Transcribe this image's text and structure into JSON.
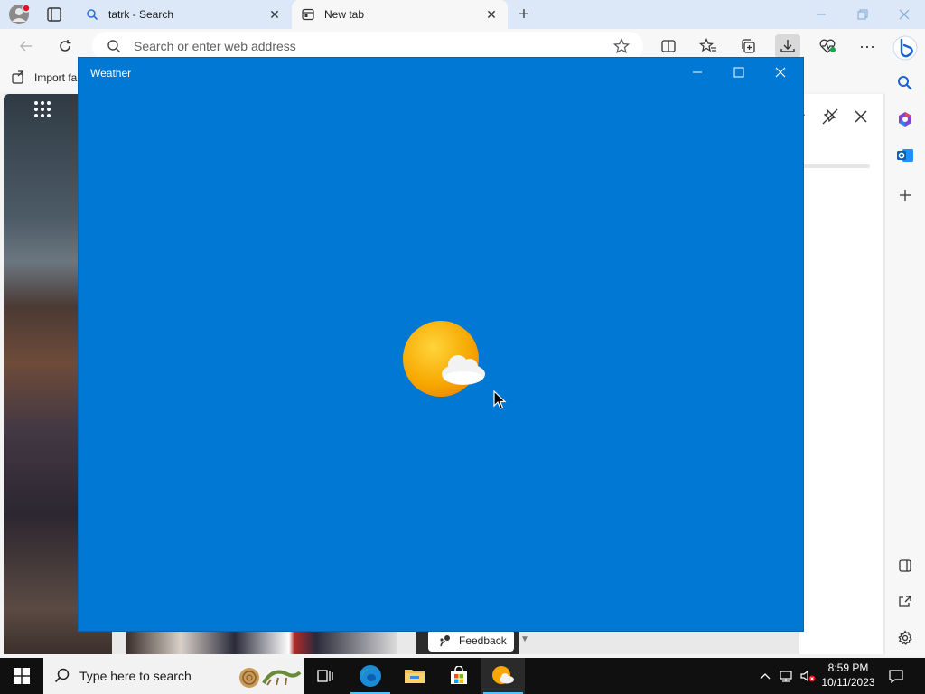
{
  "browser": {
    "tabs": [
      {
        "label": "tatrk - Search",
        "active": false
      },
      {
        "label": "New tab",
        "active": true
      }
    ],
    "address_bar": {
      "placeholder": "Search or enter web address",
      "value": ""
    },
    "favorites_bar": {
      "import_label": "Import fa"
    }
  },
  "page": {
    "feedback_label": "Feedback"
  },
  "weather_window": {
    "title": "Weather",
    "background_color": "#0078d4"
  },
  "taskbar": {
    "search_placeholder": "Type here to search",
    "time": "8:59 PM",
    "date": "10/11/2023"
  }
}
